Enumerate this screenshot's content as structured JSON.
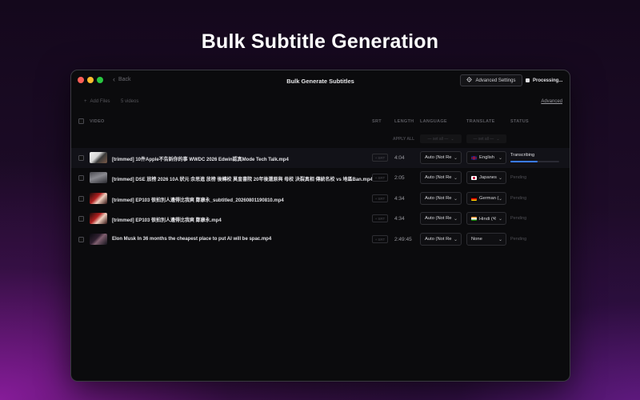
{
  "hero": {
    "title": "Bulk Subtitle Generation"
  },
  "window": {
    "back_label": "Back",
    "title": "Bulk Generate Subtitles",
    "advanced_settings_label": "Advanced Settings",
    "processing_label": "Processing..."
  },
  "toolbar": {
    "add_files_label": "Add Files",
    "video_count": "5 videos",
    "advanced_link": "Advanced"
  },
  "columns": {
    "video": "VIDEO",
    "srt": "SRT",
    "length": "LENGTH",
    "language": "LANGUAGE",
    "translate": "TRANSLATE",
    "status": "STATUS"
  },
  "apply_all": {
    "label": "APPLY ALL",
    "language_placeholder": "— set all —",
    "translate_placeholder": "— set all —"
  },
  "rows": [
    {
      "filename": "[trimmed] 10件Apple不告訴你的事 WWDC 2026 Edwin認真Mode Tech Talk.mp4",
      "srt": "SRT",
      "length": "4:04",
      "language": "Auto (Not Re",
      "translate": "English",
      "translate_flag": "gb",
      "status": "Transcribing",
      "progress": 0.55
    },
    {
      "filename": "[trimmed] DSE 放榜 2026 10A 狀元 余思進 放榜 後轉校 莫皇書院 20年後還原與 母校 決裂真相 傳統名校 vs 地區Ban.mp4",
      "srt": "SRT",
      "length": "2:05",
      "language": "Auto (Not Re",
      "translate": "Japanes",
      "translate_flag": "jp",
      "status": "Pending"
    },
    {
      "filename": "[trimmed] EP103 很拍別人邊得比我爽 鄭康永_subtitled_20260801190810.mp4",
      "srt": "SRT",
      "length": "4:34",
      "language": "Auto (Not Re",
      "translate": "German (",
      "translate_flag": "de",
      "status": "Pending"
    },
    {
      "filename": "[trimmed] EP103 很拍別人邊得比我爽 鄭康永.mp4",
      "srt": "SRT",
      "length": "4:34",
      "language": "Auto (Not Re",
      "translate": "Hindi (भ",
      "translate_flag": "in",
      "status": "Pending"
    },
    {
      "filename": "Elon Musk In 36 months the cheapest place to put AI will be spac.mp4",
      "srt": "SRT",
      "length": "2:49:45",
      "language": "Auto (Not Re",
      "translate": "None",
      "translate_flag": "",
      "status": "Pending"
    }
  ],
  "icons": {
    "back": "chevron-left-icon",
    "advanced_settings": "gear-icon",
    "processing": "stop-square-icon",
    "add_files": "plus-icon",
    "select": "chevron-down-icon"
  },
  "colors": {
    "accent": "#3a7bff",
    "window_bg": "#0b0b0d",
    "traffic_red": "#fe5f57",
    "traffic_yellow": "#febc2e",
    "traffic_green": "#28c840"
  }
}
